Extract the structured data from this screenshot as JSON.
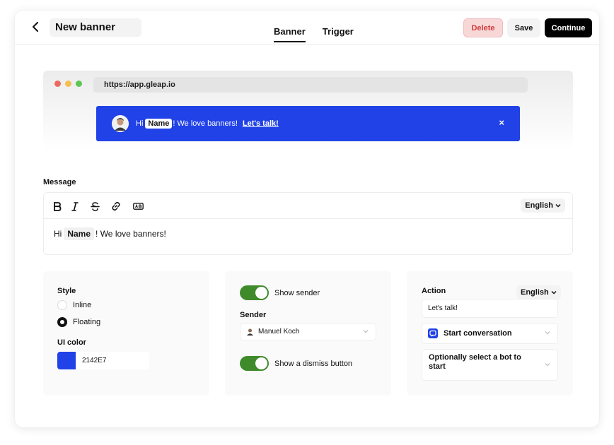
{
  "header": {
    "title": "New banner",
    "tabs": [
      {
        "label": "Banner",
        "active": true
      },
      {
        "label": "Trigger",
        "active": false
      }
    ],
    "delete_label": "Delete",
    "save_label": "Save",
    "continue_label": "Continue"
  },
  "preview": {
    "url": "https://app.gleap.io",
    "dot_colors": [
      "#ed6a5e",
      "#f5bf4f",
      "#61c554"
    ],
    "banner": {
      "greeting": "Hi",
      "name_placeholder": "Name",
      "text": "! We love banners!",
      "link_label": "Let's talk!",
      "close_symbol": "×",
      "color": "#2142E7"
    }
  },
  "message": {
    "label": "Message",
    "language": "English",
    "toolbar_icons": [
      "bold-icon",
      "italic-icon",
      "strikethrough-icon",
      "link-icon",
      "placeholder-icon"
    ],
    "content_greeting": "Hi",
    "content_name": "Name",
    "content_text": "! We love banners!"
  },
  "style_panel": {
    "style_label": "Style",
    "options": [
      {
        "label": "Inline",
        "checked": false
      },
      {
        "label": "Floating",
        "checked": true
      }
    ],
    "ui_color_label": "UI color",
    "ui_color_value": "2142E7",
    "ui_color_hex": "#2142E7"
  },
  "sender_panel": {
    "show_sender_label": "Show sender",
    "show_sender_on": true,
    "sender_label": "Sender",
    "sender_value": "Manuel Koch",
    "dismiss_label": "Show a dismiss button",
    "dismiss_on": true
  },
  "action_panel": {
    "action_label": "Action",
    "language": "English",
    "action_text": "Let's talk!",
    "action_type": "Start conversation",
    "bot_placeholder": "Optionally select a bot to start"
  }
}
